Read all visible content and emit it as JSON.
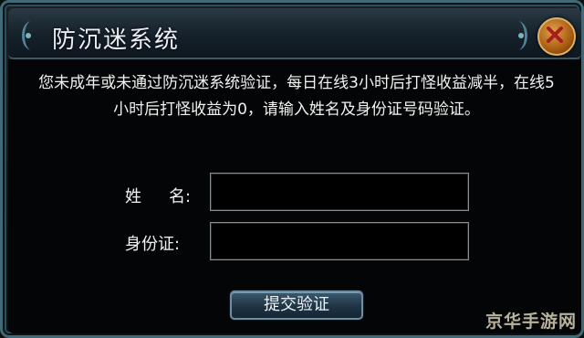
{
  "dialog": {
    "title": "防沉迷系统",
    "message": "您未成年或未通过防沉迷系统验证，每日在线3小时后打怪收益减半，在线5小时后打怪收益为0，请输入姓名及身份证号码验证。",
    "name_label_part1": "姓",
    "name_label_part2": "名:",
    "id_label": "身份证:",
    "name_value": "",
    "id_value": "",
    "submit_label": "提交验证",
    "close_icon": "close-x-icon"
  },
  "watermark": "京华手游网",
  "colors": {
    "border": "#3f6b78",
    "close_button": "#c77a22",
    "close_x": "#a51d1d",
    "text": "#f2f2f2"
  }
}
